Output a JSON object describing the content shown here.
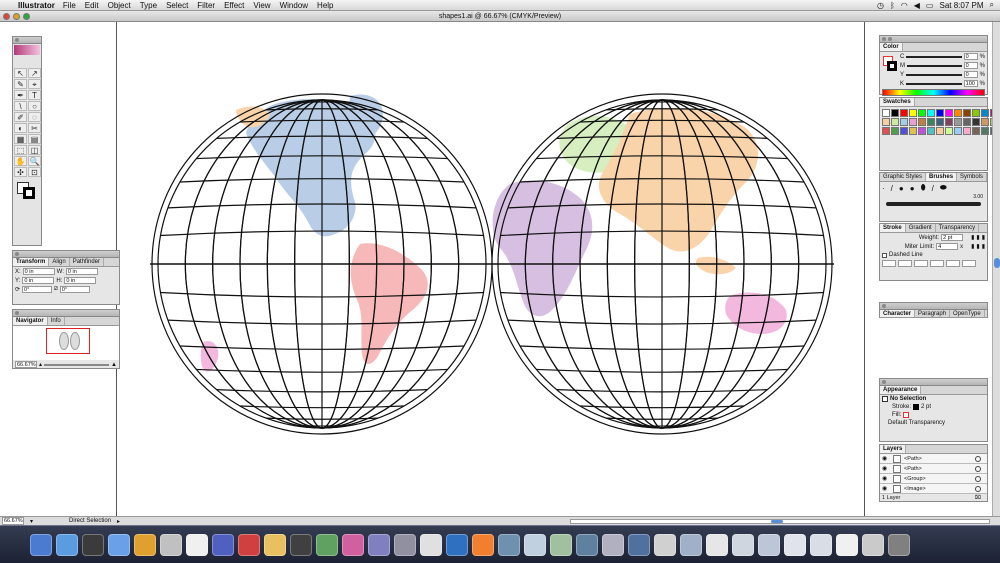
{
  "menubar": {
    "app": "Illustrator",
    "items": [
      "File",
      "Edit",
      "Object",
      "Type",
      "Select",
      "Filter",
      "Effect",
      "View",
      "Window",
      "Help"
    ],
    "clock": "Sat 8:07 PM"
  },
  "document": {
    "title": "shapes1.ai @ 66.67% (CMYK/Preview)"
  },
  "tools": [
    "↖",
    "↗",
    "✎",
    "⌖",
    "✒",
    "T",
    "\\",
    "○",
    "✐",
    "◌",
    "◐",
    "✂",
    "▦",
    "▤",
    "⬚",
    "◫",
    "✋",
    "🔍",
    "✣",
    "⊡"
  ],
  "transform_panel": {
    "tabs": [
      "Transform",
      "Align",
      "Pathfinder"
    ],
    "x_label": "X:",
    "x_value": "0 in",
    "y_label": "Y:",
    "y_value": "0 in",
    "w_label": "W:",
    "w_value": "0 in",
    "h_label": "H:",
    "h_value": "0 in",
    "angle_value": "0°",
    "shear_value": "0°"
  },
  "navigator_panel": {
    "tabs": [
      "Navigator",
      "Info"
    ],
    "zoom": "66.67%"
  },
  "color_panel": {
    "tab": "Color",
    "rows": [
      {
        "label": "C",
        "value": "0",
        "unit": "%"
      },
      {
        "label": "M",
        "value": "0",
        "unit": "%"
      },
      {
        "label": "Y",
        "value": "0",
        "unit": "%"
      },
      {
        "label": "K",
        "value": "100",
        "unit": "%"
      }
    ]
  },
  "swatches_panel": {
    "tab": "Swatches",
    "colors": [
      "#ffffff",
      "#000000",
      "#ff0000",
      "#ffff00",
      "#00ff00",
      "#00ffff",
      "#0000ff",
      "#ff00ff",
      "#ff8800",
      "#884400",
      "#88cc00",
      "#0088cc",
      "#cc0088",
      "#f5d0a0",
      "#d0e8a0",
      "#a0d0e8",
      "#e8a0d0",
      "#c08040",
      "#408060",
      "#406080",
      "#804060",
      "#999999",
      "#666666",
      "#333333",
      "#cc9966",
      "#99cc66",
      "#e05050",
      "#50a050",
      "#5050e0",
      "#e0c050",
      "#c050e0",
      "#50c0c0",
      "#ffcc99",
      "#ccff99",
      "#99ccff",
      "#ffaacc",
      "#776655",
      "#557766",
      "#556677"
    ]
  },
  "brushes_panel": {
    "tabs": [
      "Graphic Styles",
      "Brushes",
      "Symbols"
    ],
    "size_label": "3.00"
  },
  "stroke_panel": {
    "tabs": [
      "Stroke",
      "Gradient",
      "Transparency"
    ],
    "weight_label": "Weight:",
    "weight_value": "2 pt",
    "miter_label": "Miter Limit:",
    "miter_value": "4",
    "miter_unit": "x",
    "dashed_label": "Dashed Line"
  },
  "character_panel": {
    "tabs": [
      "Character",
      "Paragraph",
      "OpenType"
    ]
  },
  "appearance_panel": {
    "tab": "Appearance",
    "selection": "No Selection",
    "stroke_label": "Stroke:",
    "stroke_value": "2 pt",
    "fill_label": "Fill:",
    "default_label": "Default Transparency"
  },
  "layers_panel": {
    "tab": "Layers",
    "rows": [
      "<Path>",
      "<Path>",
      "<Group>",
      "<Image>"
    ],
    "footer": "1 Layer"
  },
  "statusbar": {
    "zoom": "66.67%",
    "tool": "Direct Selection"
  },
  "map": {
    "land_colors": {
      "north_america": "#b9cde6",
      "south_america": "#f6b8b8",
      "africa": "#d6bfe0",
      "europe": "#d6eec0",
      "asia": "#f9d3a9",
      "australia": "#f2b8dd",
      "greenland": "#b9cde6"
    }
  }
}
